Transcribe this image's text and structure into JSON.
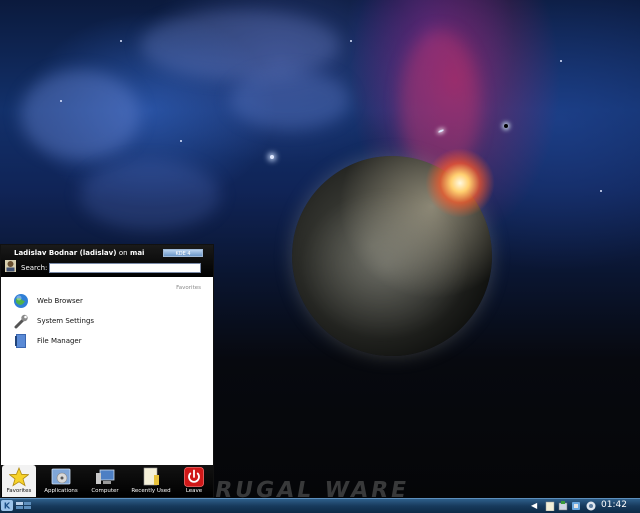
{
  "wallpaper": {
    "ground_text": "RUGAL WARE"
  },
  "kickoff": {
    "user": {
      "name": "Ladislav Bodnar (ladislav)",
      "on_word": "on",
      "host": "mai"
    },
    "kde_badge": "KDE 4",
    "search": {
      "label": "Search:",
      "value": "",
      "placeholder": ""
    },
    "favorites_title": "Favorites",
    "favorites": [
      {
        "label": "Web Browser",
        "icon": "globe-icon"
      },
      {
        "label": "System Settings",
        "icon": "wrench-icon"
      },
      {
        "label": "File Manager",
        "icon": "file-manager-icon"
      }
    ],
    "tabs": [
      {
        "label": "Favorites",
        "icon": "star-icon",
        "active": true
      },
      {
        "label": "Applications",
        "icon": "applications-icon",
        "active": false
      },
      {
        "label": "Computer",
        "icon": "computer-icon",
        "active": false
      },
      {
        "label": "Recently Used",
        "icon": "recent-icon",
        "active": false
      },
      {
        "label": "Leave",
        "icon": "power-icon",
        "active": false
      }
    ]
  },
  "panel": {
    "clock": "01:42",
    "colors": {
      "panel": "#173a5c",
      "accent": "#5d8fbd"
    }
  }
}
